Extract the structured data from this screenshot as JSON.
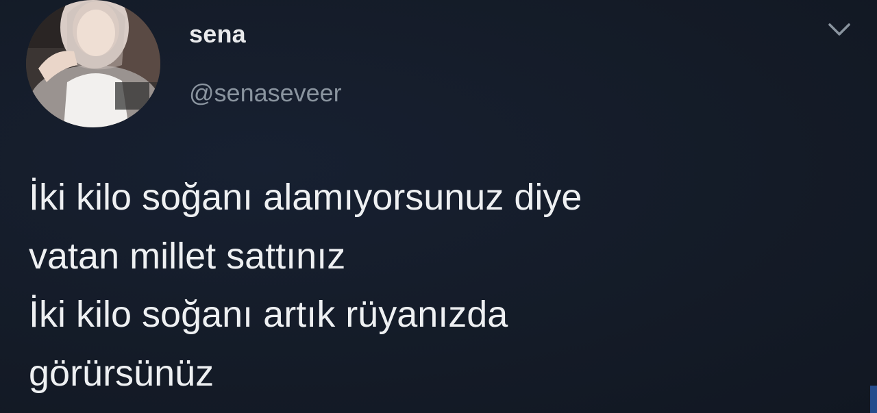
{
  "user": {
    "display_name": "sena",
    "handle": "@senaseveer",
    "avatar_icon": "profile-photo"
  },
  "menu": {
    "icon": "chevron-down-icon"
  },
  "tweet": {
    "lines": [
      "İki kilo soğanı alamıyorsunuz diye",
      "vatan millet sattınız",
      "İki kilo soğanı artık rüyanızda",
      "görürsünüz"
    ]
  },
  "colors": {
    "background": "#141a26",
    "primary_text": "#eef0f2",
    "secondary_text": "#8a949f"
  }
}
